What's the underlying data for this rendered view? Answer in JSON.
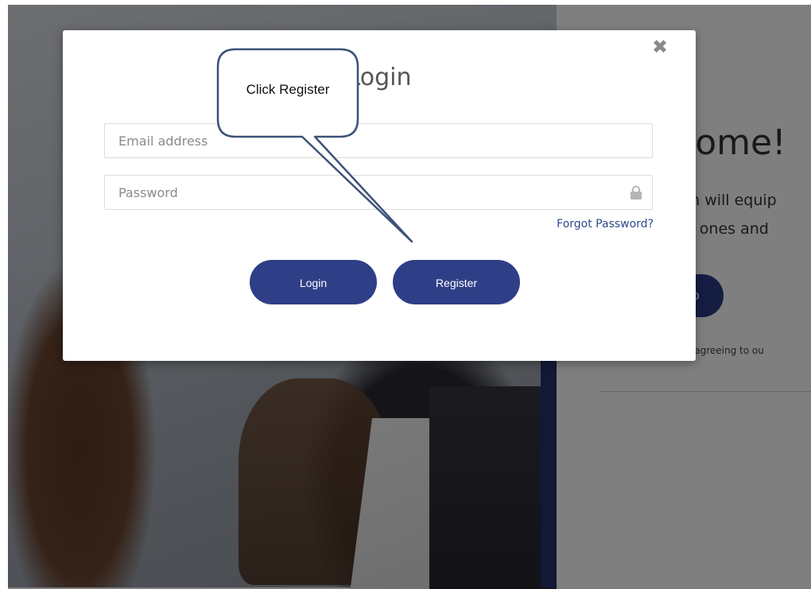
{
  "modal": {
    "title": "Login",
    "close_icon": "close-icon",
    "email": {
      "placeholder": "Email address",
      "value": ""
    },
    "password": {
      "placeholder": "Password",
      "value": "",
      "icon": "lock-icon"
    },
    "forgot_password_label": "Forgot Password?",
    "login_label": "Login",
    "register_label": "Register"
  },
  "background_page": {
    "heading_partial": "come!",
    "tagline_line1": "am will equip",
    "tagline_line2": "ed ones and",
    "cta_partial": "o",
    "agree_partial": "are agreeing to ou"
  },
  "annotation": {
    "callout_text": "Click Register"
  },
  "colors": {
    "button_bg": "#2f3f87",
    "link": "#2d4a8a",
    "accent_bar": "#24336e"
  }
}
